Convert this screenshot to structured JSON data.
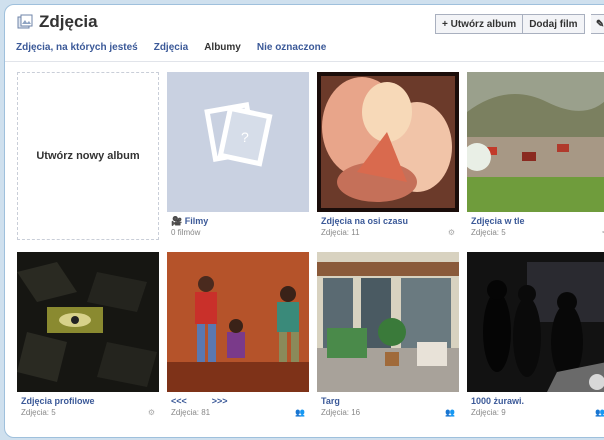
{
  "header": {
    "title": "Zdjęcia",
    "add_album": "+ Utwórz album",
    "add_film": "Dodaj film",
    "edit_glyph": "✎"
  },
  "tabs": [
    {
      "label": "Zdjęcia, na których jesteś",
      "active": false
    },
    {
      "label": "Zdjęcia",
      "active": false
    },
    {
      "label": "Albumy",
      "active": true
    },
    {
      "label": "Nie oznaczone",
      "active": false
    }
  ],
  "new_album": {
    "label": "Utwórz nowy album"
  },
  "albums": [
    {
      "title": "Filmy",
      "count": "0 filmów",
      "badge": ""
    },
    {
      "title": "Zdjęcia na osi czasu",
      "count": "Zdjęcia: 11",
      "badge": "⚙"
    },
    {
      "title": "Zdjęcia w tle",
      "count": "Zdjęcia: 5",
      "badge": "◔"
    },
    {
      "title": "Zdjęcia profilowe",
      "count": "Zdjęcia: 5",
      "badge": "⚙"
    },
    {
      "title": "<<<          >>>",
      "count": "Zdjęcia: 81",
      "badge": "👥"
    },
    {
      "title": "Targ",
      "count": "Zdjęcia: 16",
      "badge": "👥"
    },
    {
      "title": "1000 żurawi.",
      "count": "Zdjęcia: 9",
      "badge": "👥"
    }
  ]
}
